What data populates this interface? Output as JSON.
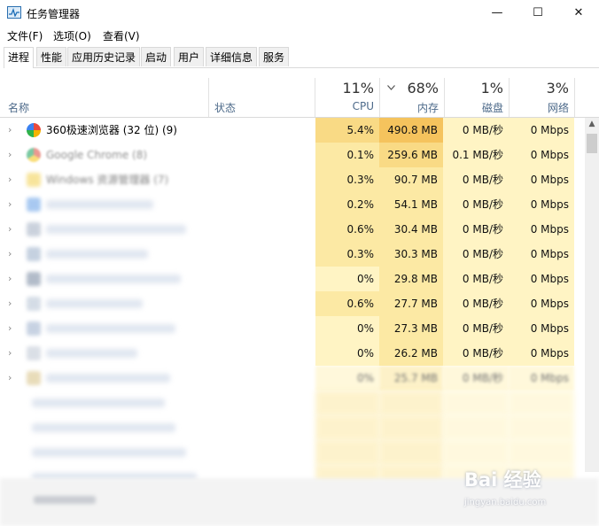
{
  "window": {
    "title": "任务管理器",
    "icon": "task-manager-icon",
    "controls": {
      "minimize": "—",
      "maximize": "☐",
      "close": "✕"
    }
  },
  "menu": [
    "文件(F)",
    "选项(O)",
    "查看(V)"
  ],
  "tabs": [
    "进程",
    "性能",
    "应用历史记录",
    "启动",
    "用户",
    "详细信息",
    "服务"
  ],
  "active_tab": "进程",
  "columns": {
    "name": "名称",
    "status": "状态",
    "cpu": {
      "pct": "11%",
      "label": "CPU"
    },
    "memory": {
      "pct": "68%",
      "label": "内存",
      "sort_indicator": "chevron-down-icon"
    },
    "disk": {
      "pct": "1%",
      "label": "磁盘"
    },
    "network": {
      "pct": "3%",
      "label": "网络"
    }
  },
  "colors": {
    "heat_light": "#fff4c4",
    "heat_mid": "#fce9a4",
    "heat_strong": "#f9da85",
    "heat_hot": "#f5c35d",
    "header_text": "#4d6a8a"
  },
  "processes": [
    {
      "name": "360极速浏览器 (32 位) (9)",
      "cpu": "5.4%",
      "memory": "490.8 MB",
      "disk": "0 MB/秒",
      "network": "0 Mbps",
      "icon": "360-browser-icon"
    },
    {
      "name": "Google Chrome (8)",
      "cpu": "0.1%",
      "memory": "259.6 MB",
      "disk": "0.1 MB/秒",
      "network": "0 Mbps",
      "icon": "chrome-icon"
    },
    {
      "name": "Windows 资源管理器 (7)",
      "cpu": "0.3%",
      "memory": "90.7 MB",
      "disk": "0 MB/秒",
      "network": "0 Mbps",
      "icon": "folder-icon"
    },
    {
      "name": "",
      "cpu": "0.2%",
      "memory": "54.1 MB",
      "disk": "0 MB/秒",
      "network": "0 Mbps",
      "icon": "app-icon"
    },
    {
      "name": "",
      "cpu": "0.6%",
      "memory": "30.4 MB",
      "disk": "0 MB/秒",
      "network": "0 Mbps",
      "icon": "app-icon"
    },
    {
      "name": "",
      "cpu": "0.3%",
      "memory": "30.3 MB",
      "disk": "0 MB/秒",
      "network": "0 Mbps",
      "icon": "app-icon"
    },
    {
      "name": "",
      "cpu": "0%",
      "memory": "29.8 MB",
      "disk": "0 MB/秒",
      "network": "0 Mbps",
      "icon": "app-icon"
    },
    {
      "name": "",
      "cpu": "0.6%",
      "memory": "27.7 MB",
      "disk": "0 MB/秒",
      "network": "0 Mbps",
      "icon": "app-icon"
    },
    {
      "name": "",
      "cpu": "0%",
      "memory": "27.3 MB",
      "disk": "0 MB/秒",
      "network": "0 Mbps",
      "icon": "app-icon"
    },
    {
      "name": "",
      "cpu": "0%",
      "memory": "26.2 MB",
      "disk": "0 MB/秒",
      "network": "0 Mbps",
      "icon": "app-icon"
    },
    {
      "name": "",
      "cpu": "0%",
      "memory": "25.7 MB",
      "disk": "0 MB/秒",
      "network": "0 Mbps",
      "icon": "app-icon"
    }
  ],
  "watermark": {
    "main": "Bai 经验",
    "sub": "jingyan.baidu.com"
  }
}
